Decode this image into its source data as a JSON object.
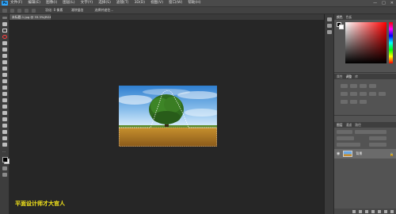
{
  "app": {
    "logo": "Ps",
    "menu": [
      "文件(F)",
      "编辑(E)",
      "图像(I)",
      "图层(L)",
      "文字(Y)",
      "选择(S)",
      "滤镜(T)",
      "3D(D)",
      "视图(V)",
      "窗口(W)",
      "帮助(H)"
    ],
    "window_controls": [
      "—",
      "□",
      "✕"
    ]
  },
  "options_bar": {
    "labels": [
      "羽化: 0 像素",
      "消除锯齿",
      "选择并遮住..."
    ]
  },
  "document": {
    "tab_label": "未标题-1.jpg @ 33.3%(RGB/8#) ×"
  },
  "panels": {
    "color_tabs": [
      "颜色",
      "色板"
    ],
    "adjust_tabs": [
      "属性",
      "调整",
      "库"
    ],
    "layers_tabs": [
      "图层",
      "通道",
      "路径"
    ],
    "layer_name": "背景",
    "fg_color": "#000000",
    "bg_color": "#ffffff",
    "accent": "#31a8ff"
  },
  "watermark": "平面设计师才大官人"
}
